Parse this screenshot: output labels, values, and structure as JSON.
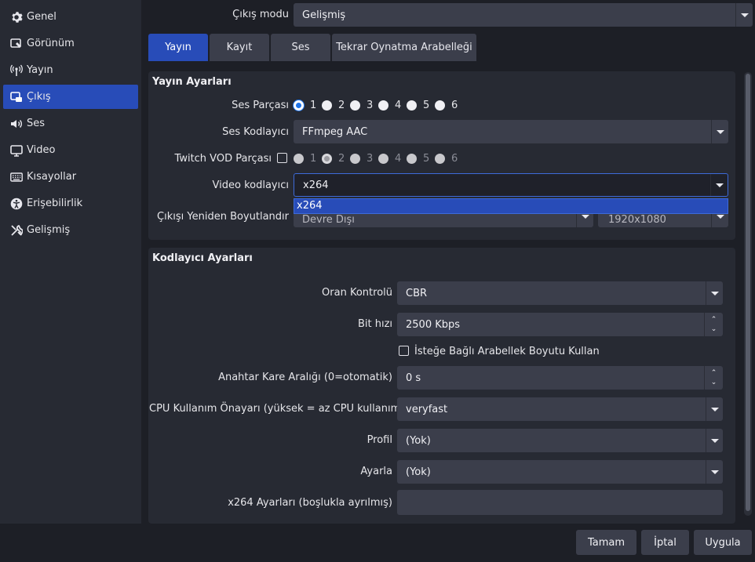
{
  "sidebar": {
    "items": [
      {
        "label": "Genel",
        "icon": "gear-icon"
      },
      {
        "label": "Görünüm",
        "icon": "palette-icon"
      },
      {
        "label": "Yayın",
        "icon": "broadcast-icon"
      },
      {
        "label": "Çıkış",
        "icon": "output-icon"
      },
      {
        "label": "Ses",
        "icon": "speaker-icon"
      },
      {
        "label": "Video",
        "icon": "monitor-icon"
      },
      {
        "label": "Kısayollar",
        "icon": "keyboard-icon"
      },
      {
        "label": "Erişebilirlik",
        "icon": "accessibility-icon"
      },
      {
        "label": "Gelişmiş",
        "icon": "tools-icon"
      }
    ],
    "active": "Çıkış"
  },
  "output_mode": {
    "label": "Çıkış modu",
    "value": "Gelişmiş"
  },
  "tabs": [
    "Yayın",
    "Kayıt",
    "Ses",
    "Tekrar Oynatma Arabelleği"
  ],
  "stream_settings": {
    "title": "Yayın Ayarları",
    "audio_track": {
      "label": "Ses Parçası",
      "options": [
        "1",
        "2",
        "3",
        "4",
        "5",
        "6"
      ],
      "selected": "1"
    },
    "audio_encoder": {
      "label": "Ses Kodlayıcı",
      "value": "FFmpeg AAC"
    },
    "twitch_vod": {
      "label": "Twitch VOD Parçası",
      "options": [
        "1",
        "2",
        "3",
        "4",
        "5",
        "6"
      ],
      "selected": "2"
    },
    "video_encoder": {
      "label": "Video kodlayıcı",
      "value": "x264",
      "dropdown_options": [
        "x264"
      ]
    },
    "rescale": {
      "label": "Çıkışı Yeniden Boyutlandır",
      "mode": "Devre Dışı",
      "resolution": "1920x1080"
    }
  },
  "encoder_settings": {
    "title": "Kodlayıcı Ayarları",
    "rate_control": {
      "label": "Oran Kontrolü",
      "value": "CBR"
    },
    "bitrate": {
      "label": "Bit hızı",
      "value": "2500 Kbps"
    },
    "custom_buffer": {
      "label": "İsteğe Bağlı Arabellek Boyutu Kullan"
    },
    "keyframe": {
      "label": "Anahtar Kare Aralığı (0=otomatik)",
      "value": "0 s"
    },
    "cpu_preset": {
      "label": "CPU Kullanım Önayarı (yüksek = az CPU kullanımı)",
      "value": "veryfast"
    },
    "profile": {
      "label": "Profil",
      "value": "(Yok)"
    },
    "tune": {
      "label": "Ayarla",
      "value": "(Yok)"
    },
    "x264_options": {
      "label": "x264 Ayarları (boşlukla ayrılmış)",
      "value": ""
    }
  },
  "buttons": {
    "ok": "Tamam",
    "cancel": "İptal",
    "apply": "Uygula"
  },
  "colors": {
    "accent": "#284cb8",
    "background": "#1d1f26",
    "panel": "#272a33",
    "control": "#3b3e4b"
  }
}
